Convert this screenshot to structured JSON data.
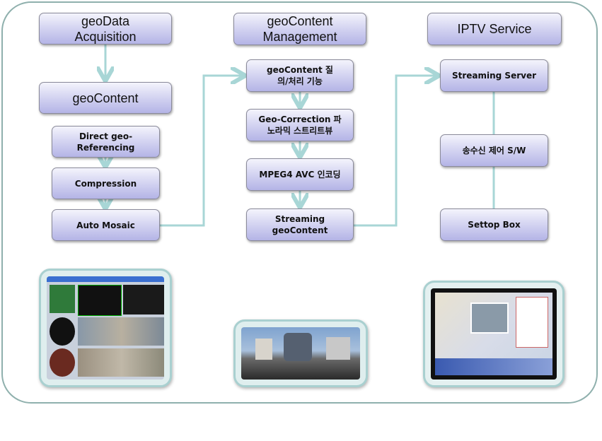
{
  "columns": [
    {
      "header": "geoData Acquisition",
      "items": [
        "geoContent",
        "Direct geo-Referencing",
        "Compression",
        "Auto Mosaic"
      ]
    },
    {
      "header": "geoContent Management",
      "items": [
        "geoContent 질의/처리 기능",
        "Geo-Correction 파노라믹 스트리트뷰",
        "MPEG4 AVC 인코딩",
        "Streaming geoContent"
      ]
    },
    {
      "header": "IPTV Service",
      "items": [
        "Streaming Server",
        "송수신 제어 S/W",
        "Settop Box"
      ]
    }
  ],
  "images": [
    "acquisition-software-screenshot",
    "panoramic-street-view",
    "iptv-map-display"
  ],
  "colors": {
    "connector": "#a8d6d6",
    "frame": "#8fb0ad",
    "box_top": "#f4f4fc",
    "box_bottom": "#b4b4e6"
  }
}
